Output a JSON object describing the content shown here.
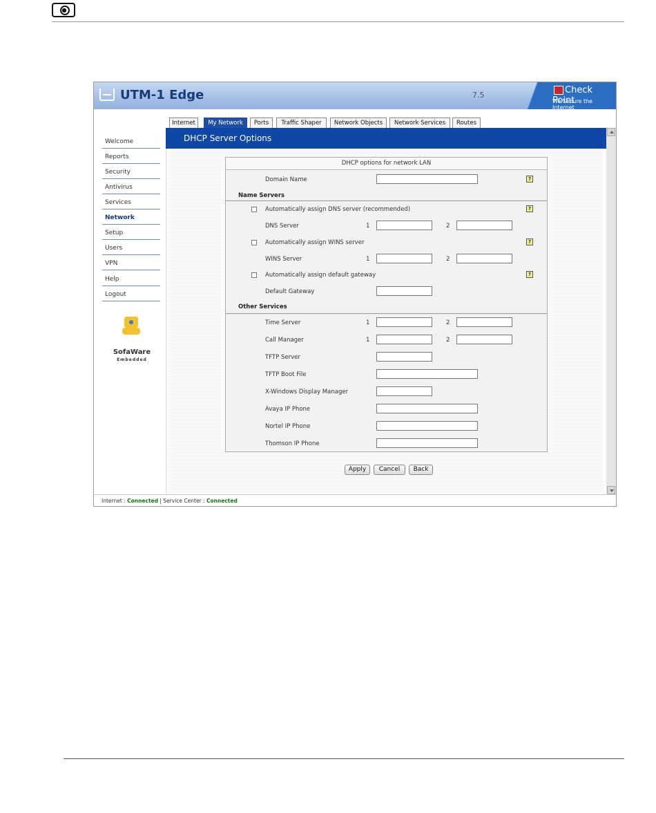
{
  "app": {
    "title": "UTM-1 Edge",
    "version": "7.5",
    "brand": "Check Point",
    "brand_tagline": "We Secure the Internet"
  },
  "sidebar": {
    "items": [
      {
        "label": "Welcome"
      },
      {
        "label": "Reports"
      },
      {
        "label": "Security"
      },
      {
        "label": "Antivirus"
      },
      {
        "label": "Services"
      },
      {
        "label": "Network",
        "active": true
      },
      {
        "label": "Setup"
      },
      {
        "label": "Users"
      },
      {
        "label": "VPN"
      },
      {
        "label": "Help"
      },
      {
        "label": "Logout"
      }
    ],
    "logo_text": "SofaWare",
    "logo_subtext": "Embedded"
  },
  "tabs": [
    {
      "label": "Internet"
    },
    {
      "label": "My Network",
      "active": true
    },
    {
      "label": "Ports"
    },
    {
      "label": "Traffic Shaper"
    },
    {
      "label": "Network Objects"
    },
    {
      "label": "Network Services"
    },
    {
      "label": "Routes"
    }
  ],
  "page_title": "DHCP Server Options",
  "form": {
    "title": "DHCP options for network LAN",
    "domain_name_label": "Domain Name",
    "name_servers_heading": "Name Servers",
    "auto_dns_label": "Automatically assign DNS server (recommended)",
    "dns_server_label": "DNS Server",
    "auto_wins_label": "Automatically assign WINS server",
    "wins_server_label": "WINS Server",
    "auto_gateway_label": "Automatically assign default gateway",
    "default_gateway_label": "Default Gateway",
    "other_services_heading": "Other Services",
    "time_server_label": "Time Server",
    "call_manager_label": "Call Manager",
    "tftp_server_label": "TFTP Server",
    "tftp_boot_file_label": "TFTP Boot File",
    "xwindows_label": "X-Windows Display Manager",
    "avaya_label": "Avaya IP Phone",
    "nortel_label": "Nortel IP Phone",
    "thomson_label": "Thomson IP Phone",
    "index_1": "1",
    "index_2": "2",
    "help_glyph": "?"
  },
  "buttons": {
    "apply": "Apply",
    "cancel": "Cancel",
    "back": "Back"
  },
  "status": {
    "internet_label": "Internet : ",
    "internet_value": "Connected",
    "separator": " | Service Center : ",
    "service_center_value": "Connected"
  },
  "colors": {
    "header_blue": "#0e47a8",
    "status_green": "#0f7b0f"
  }
}
